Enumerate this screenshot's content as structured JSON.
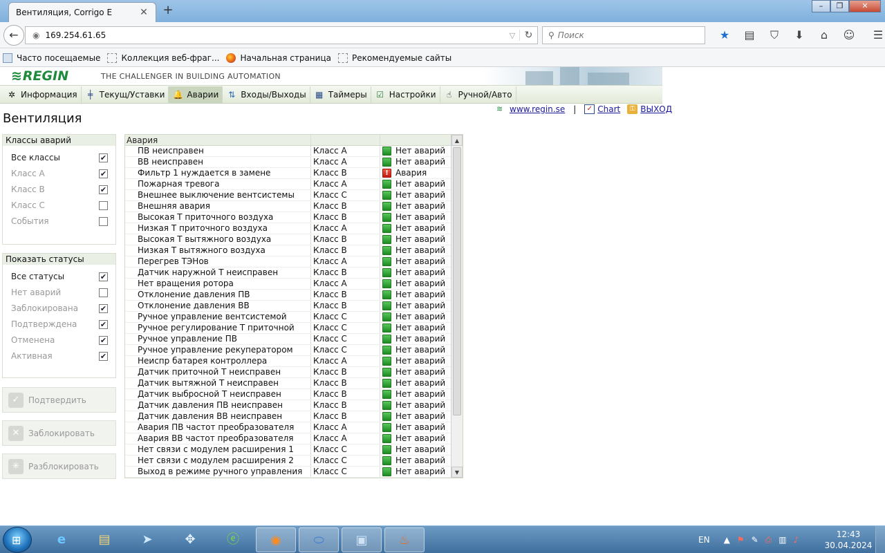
{
  "browser": {
    "tab_title": "Вентиляция, Corrigo E",
    "tab_close": "✕",
    "new_tab": "+",
    "url": "169.254.61.65",
    "search_placeholder": "Поиск",
    "bookmarks": [
      "Часто посещаемые",
      "Коллекция веб-фраг...",
      "Начальная страница",
      "Рекомендуемые сайты"
    ]
  },
  "header": {
    "logo": "REGIN",
    "tagline": "THE CHALLENGER IN BUILDING AUTOMATION"
  },
  "menu": [
    {
      "label": "Информация",
      "icon": "info-icon"
    },
    {
      "label": "Текущ/Уставки",
      "icon": "gauge-icon"
    },
    {
      "label": "Аварии",
      "icon": "alarm-bell-icon",
      "active": true
    },
    {
      "label": "Входы/Выходы",
      "icon": "io-icon"
    },
    {
      "label": "Таймеры",
      "icon": "calendar-icon"
    },
    {
      "label": "Настройки",
      "icon": "settings-check-icon"
    },
    {
      "label": "Ручной/Авто",
      "icon": "hand-icon"
    }
  ],
  "links": {
    "site": "www.regin.se",
    "separator": "|",
    "chart": "Chart",
    "exit": "ВЫХОД"
  },
  "page_title": "Вентиляция",
  "alarm_classes": {
    "title": "Классы аварий",
    "items": [
      {
        "label": "Все классы",
        "checked": "✔",
        "dim": false
      },
      {
        "label": "Класс А",
        "checked": "✔",
        "dim": true
      },
      {
        "label": "Класс В",
        "checked": "✔",
        "dim": true
      },
      {
        "label": "Класс С",
        "checked": "",
        "dim": true
      },
      {
        "label": "События",
        "checked": "",
        "dim": true
      }
    ]
  },
  "statuses": {
    "title": "Показать статусы",
    "items": [
      {
        "label": "Все статусы",
        "checked": "✔",
        "dim": false
      },
      {
        "label": "Нет аварий",
        "checked": "",
        "dim": true
      },
      {
        "label": "Заблокирована",
        "checked": "✔",
        "dim": true
      },
      {
        "label": "Подтверждена",
        "checked": "✔",
        "dim": true
      },
      {
        "label": "Отменена",
        "checked": "✔",
        "dim": true
      },
      {
        "label": "Активная",
        "checked": "✔",
        "dim": true
      }
    ]
  },
  "actions": {
    "confirm": "Подтвердить",
    "block": "Заблокировать",
    "unblock": "Разблокировать"
  },
  "table": {
    "header": "Авария",
    "rows": [
      [
        "ПВ неисправен",
        "Класс А",
        "Нет аварий"
      ],
      [
        "ВВ неисправен",
        "Класс А",
        "Нет аварий"
      ],
      [
        "Фильтр 1 нуждается в замене",
        "Класс В",
        "Авария"
      ],
      [
        "Пожарная тревога",
        "Класс А",
        "Нет аварий"
      ],
      [
        "Внешнее выключение вентсистемы",
        "Класс С",
        "Нет аварий"
      ],
      [
        "Внешняя авария",
        "Класс В",
        "Нет аварий"
      ],
      [
        "Высокая Т приточного воздуха",
        "Класс В",
        "Нет аварий"
      ],
      [
        "Низкая Т приточного воздуха",
        "Класс А",
        "Нет аварий"
      ],
      [
        "Высокая Т вытяжного воздуха",
        "Класс В",
        "Нет аварий"
      ],
      [
        "Низкая Т вытяжного воздуха",
        "Класс В",
        "Нет аварий"
      ],
      [
        "Перегрев ТЭНов",
        "Класс А",
        "Нет аварий"
      ],
      [
        "Датчик наружной Т неисправен",
        "Класс В",
        "Нет аварий"
      ],
      [
        "Нет вращения ротора",
        "Класс А",
        "Нет аварий"
      ],
      [
        "Отклонение давления ПВ",
        "Класс В",
        "Нет аварий"
      ],
      [
        "Отклонение давления ВВ",
        "Класс В",
        "Нет аварий"
      ],
      [
        "Ручное управление вентсистемой",
        "Класс С",
        "Нет аварий"
      ],
      [
        "Ручное регулирование Т приточной",
        "Класс С",
        "Нет аварий"
      ],
      [
        "Ручное управление ПВ",
        "Класс С",
        "Нет аварий"
      ],
      [
        "Ручное управление рекуператором",
        "Класс С",
        "Нет аварий"
      ],
      [
        "Неиспр батарея контроллера",
        "Класс А",
        "Нет аварий"
      ],
      [
        "Датчик приточной Т неисправен",
        "Класс В",
        "Нет аварий"
      ],
      [
        "Датчик вытяжной Т неисправен",
        "Класс В",
        "Нет аварий"
      ],
      [
        "Датчик выбросной Т неисправен",
        "Класс В",
        "Нет аварий"
      ],
      [
        "Датчик давления ПВ неисправен",
        "Класс В",
        "Нет аварий"
      ],
      [
        "Датчик давления ВВ неисправен",
        "Класс В",
        "Нет аварий"
      ],
      [
        "Авария ПВ частот преобразователя",
        "Класс А",
        "Нет аварий"
      ],
      [
        "Авария ВВ частот преобразователя",
        "Класс А",
        "Нет аварий"
      ],
      [
        "Нет связи с модулем расширения 1",
        "Класс С",
        "Нет аварий"
      ],
      [
        "Нет связи с модулем расширения 2",
        "Класс С",
        "Нет аварий"
      ],
      [
        "Выход в режиме ручного управления",
        "Класс С",
        "Нет аварий"
      ]
    ]
  },
  "taskbar": {
    "lang": "EN",
    "time": "12:43",
    "date": "30.04.2024"
  },
  "colors": {
    "ok": "#2fa83a",
    "alarm": "#d8281a",
    "regin_green": "#1e8a3c"
  }
}
